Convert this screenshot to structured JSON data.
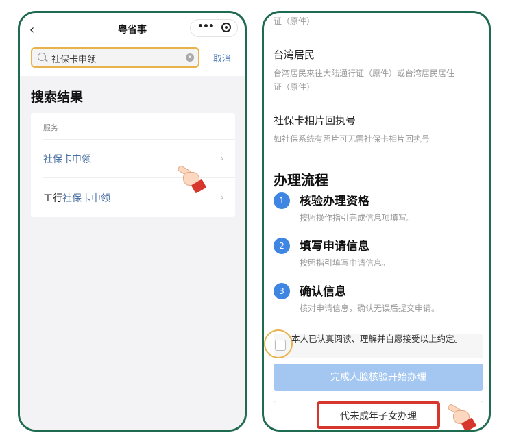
{
  "left": {
    "header": {
      "back_icon": "chevron-left-icon",
      "title": "粤省事",
      "more_icon": "more-dots-icon",
      "close_icon": "close-circle-icon"
    },
    "search": {
      "value": "社保卡申领",
      "cancel": "取消"
    },
    "results": {
      "title": "搜索结果",
      "section": "服务",
      "items": [
        {
          "highlight": "社保卡申领",
          "prefix": ""
        },
        {
          "prefix": "工行",
          "highlight": "社保卡申领"
        }
      ]
    }
  },
  "right": {
    "docs": {
      "top_cont": "证（原件）",
      "taiwan_title": "台湾居民",
      "taiwan_desc_1": "台湾居民来往大陆通行证（原件）或台湾居民居住",
      "taiwan_desc_2": "证（原件）",
      "photo_title": "社保卡相片回执号",
      "photo_desc": "如社保系统有照片可无需社保卡相片回执号"
    },
    "flow": {
      "title": "办理流程",
      "steps": [
        {
          "num": "1",
          "title": "核验办理资格",
          "desc": "按照操作指引完成信息项填写。"
        },
        {
          "num": "2",
          "title": "填写申请信息",
          "desc": "按照指引填写申请信息。"
        },
        {
          "num": "3",
          "title": "确认信息",
          "desc": "核对申请信息，确认无误后提交申请。"
        }
      ]
    },
    "agreement": "本人已认真阅读、理解并自愿接受以上约定。",
    "buttons": {
      "face_verify": "完成人脸核验开始办理",
      "minor": "代未成年子女办理"
    }
  },
  "colors": {
    "frame": "#1f6b4f",
    "highlight_ring": "#e8b24d",
    "accent_blue": "#3f86e2",
    "link_blue": "#4a6fa3",
    "red_box": "#d7362c"
  }
}
